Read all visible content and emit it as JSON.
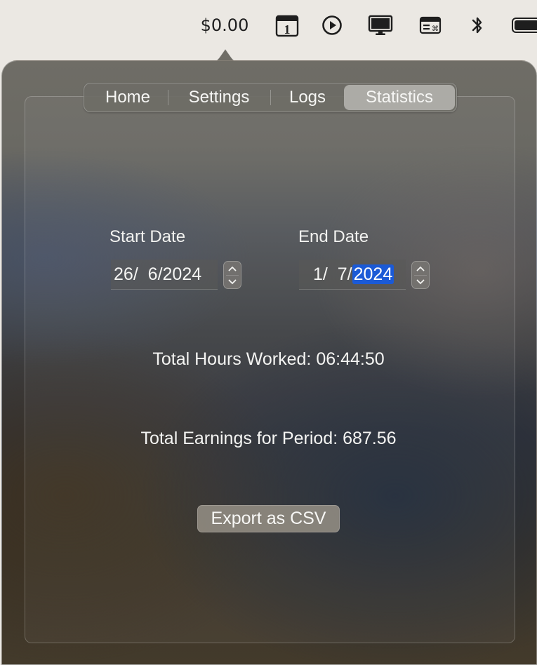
{
  "menubar": {
    "earnings": "$0.00",
    "calendar_day": "1",
    "icons": [
      "calendar-icon",
      "play-icon",
      "display-icon",
      "keyboard-shortcut-icon",
      "bluetooth-icon",
      "battery-icon"
    ]
  },
  "tabs": [
    {
      "label": "Home",
      "selected": false
    },
    {
      "label": "Settings",
      "selected": false
    },
    {
      "label": "Logs",
      "selected": false
    },
    {
      "label": "Statistics",
      "selected": true
    }
  ],
  "start_date": {
    "label": "Start Date",
    "day": "26",
    "month": "6",
    "year": "2024"
  },
  "end_date": {
    "label": "End Date",
    "day": "1",
    "month": "7",
    "year": "2024",
    "selected_part": "year"
  },
  "stats": {
    "hours": "Total Hours Worked: 06:44:50",
    "earnings": "Total Earnings for Period: 687.56"
  },
  "export_button": "Export as CSV",
  "colors": {
    "selection_highlight": "#1b5ad6",
    "menubar_background": "#ebe8e3"
  }
}
